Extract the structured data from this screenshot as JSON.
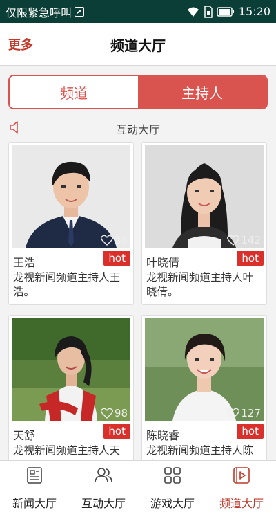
{
  "status_bar": {
    "carrier_text": "仅限紧急呼叫",
    "time": "15:20",
    "icons": [
      "screenshot-icon",
      "wifi-icon",
      "sim-icon",
      "battery-icon"
    ]
  },
  "header": {
    "more_label": "更多",
    "title": "频道大厅"
  },
  "segment": {
    "left_label": "频道",
    "right_label": "主持人",
    "selected": "主持人"
  },
  "section": {
    "icon": "speaker-icon",
    "label": "互动大厅"
  },
  "hosts": [
    {
      "name": "王浩",
      "badge": "hot",
      "likes": "86",
      "description": "龙视新闻频道主持人王浩。"
    },
    {
      "name": "叶晓倩",
      "badge": "hot",
      "likes": "142",
      "description": "龙视新闻频道主持人叶晓倩。"
    },
    {
      "name": "天舒",
      "badge": "hot",
      "likes": "98",
      "description": "龙视新闻频道主持人天"
    },
    {
      "name": "陈晓睿",
      "badge": "hot",
      "likes": "127",
      "description": "龙视新闻频道主持人陈晓"
    }
  ],
  "bottom_nav": {
    "items": [
      {
        "label": "新闻大厅",
        "icon": "news-icon"
      },
      {
        "label": "互动大厅",
        "icon": "people-icon"
      },
      {
        "label": "游戏大厅",
        "icon": "grid-icon"
      },
      {
        "label": "频道大厅",
        "icon": "video-icon"
      }
    ],
    "active": "频道大厅"
  },
  "colors": {
    "accent": "#d9534f",
    "status_bar": "#0a3e36",
    "hot_badge": "#d9302c"
  }
}
